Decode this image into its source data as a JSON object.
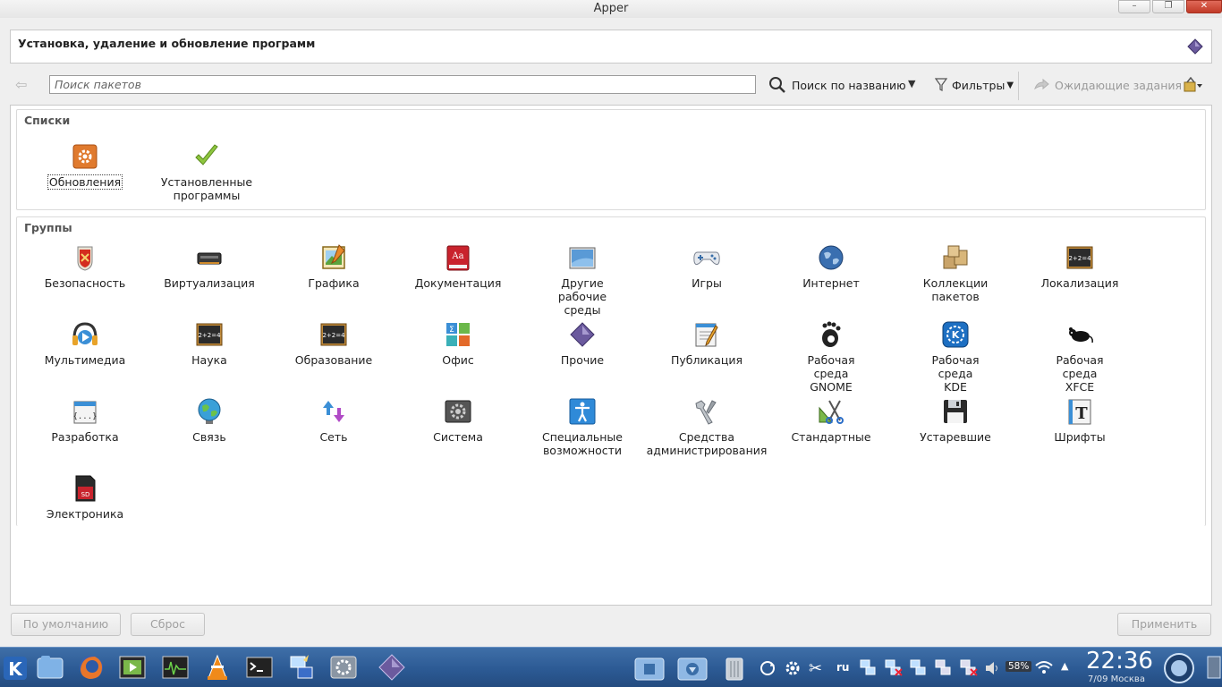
{
  "window": {
    "title": "Apper"
  },
  "header": {
    "title": "Установка, удаление и обновление программ",
    "icon": "diamond-icon"
  },
  "toolbar": {
    "search_placeholder": "Поиск пакетов",
    "search_button": "Поиск по названию",
    "filters_button": "Фильтры",
    "pending_button": "Ожидающие задания"
  },
  "lists": {
    "title": "Списки",
    "items": [
      {
        "label": "Обновления",
        "icon": "updates-icon"
      },
      {
        "label": "Установленные\nпрограммы",
        "icon": "installed-check-icon"
      }
    ]
  },
  "groups": {
    "title": "Группы",
    "items": [
      {
        "label": "Безопасность",
        "icon": "security-shield-icon"
      },
      {
        "label": "Виртуализация",
        "icon": "virtualization-icon"
      },
      {
        "label": "Графика",
        "icon": "graphics-icon"
      },
      {
        "label": "Документация",
        "icon": "documentation-book-icon"
      },
      {
        "label": "Другие\nрабочие\nсреды",
        "icon": "desktop-screen-icon"
      },
      {
        "label": "Игры",
        "icon": "gamepad-icon"
      },
      {
        "label": "Интернет",
        "icon": "globe-icon"
      },
      {
        "label": "Коллекции\nпакетов",
        "icon": "packages-boxes-icon"
      },
      {
        "label": "Локализация",
        "icon": "localization-board-icon"
      },
      {
        "label": "Мультимедиа",
        "icon": "multimedia-headphones-icon"
      },
      {
        "label": "Наука",
        "icon": "science-board-icon"
      },
      {
        "label": "Образование",
        "icon": "education-board-icon"
      },
      {
        "label": "Офис",
        "icon": "office-icon"
      },
      {
        "label": "Прочие",
        "icon": "other-diamond-icon"
      },
      {
        "label": "Публикация",
        "icon": "publishing-icon"
      },
      {
        "label": "Рабочая\nсреда\nGNOME",
        "icon": "gnome-foot-icon"
      },
      {
        "label": "Рабочая\nсреда\nKDE",
        "icon": "kde-icon"
      },
      {
        "label": "Рабочая\nсреда\nXFCE",
        "icon": "xfce-mouse-icon"
      },
      {
        "label": "Разработка",
        "icon": "development-icon"
      },
      {
        "label": "Связь",
        "icon": "communication-globe-icon"
      },
      {
        "label": "Сеть",
        "icon": "network-arrows-icon"
      },
      {
        "label": "Система",
        "icon": "system-gear-icon"
      },
      {
        "label": "Специальные\nвозможности",
        "icon": "accessibility-icon"
      },
      {
        "label": "Средства\nадминистрирования",
        "icon": "admin-tools-icon"
      },
      {
        "label": "Стандартные",
        "icon": "accessories-icon"
      },
      {
        "label": "Устаревшие",
        "icon": "legacy-floppy-icon"
      },
      {
        "label": "Шрифты",
        "icon": "fonts-icon"
      },
      {
        "label": "Электроника",
        "icon": "electronics-sd-icon"
      }
    ]
  },
  "buttons": {
    "defaults": "По умолчанию",
    "reset": "Сброс",
    "apply": "Применить"
  },
  "taskbar": {
    "apps": [
      "kde-menu-icon",
      "file-manager-icon",
      "firefox-icon",
      "video-player-icon",
      "system-monitor-icon",
      "vlc-icon",
      "terminal-icon",
      "network-settings-icon",
      "system-settings-icon",
      "apper-icon"
    ],
    "lang": "ru",
    "battery": "58%",
    "clock_time": "22:36",
    "clock_date": "7/09 Москва"
  },
  "colors": {
    "taskbar": "#2c5a94",
    "accent_orange": "#e07a2e"
  }
}
